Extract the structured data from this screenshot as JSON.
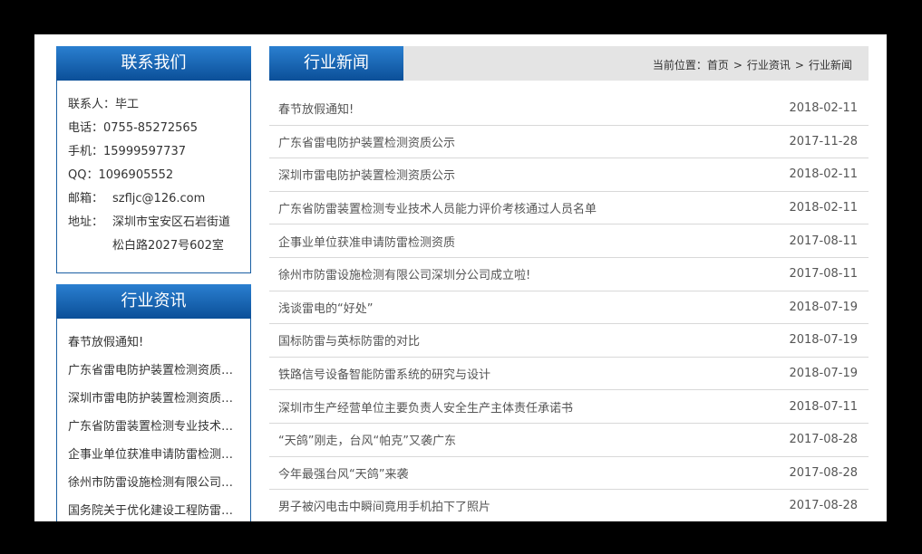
{
  "contact": {
    "title": "联系我们",
    "rows": [
      {
        "label": "联系人：",
        "value": "毕工"
      },
      {
        "label": "电话：",
        "value": "0755-85272565"
      },
      {
        "label": "手机：",
        "value": "15999597737"
      },
      {
        "label": "QQ：",
        "value": "1096905552"
      },
      {
        "label": "邮箱：",
        "value": "szfljc@126.com"
      },
      {
        "label": "地址：",
        "value": "深圳市宝安区石岩街道松白路2027号602室"
      }
    ]
  },
  "industry": {
    "title": "行业资讯",
    "items": [
      "春节放假通知!",
      "广东省雷电防护装置检测资质公示",
      "深圳市雷电防护装置检测资质公示",
      "广东省防雷装置检测专业技术人...",
      "企事业单位获准申请防雷检测资质",
      "徐州市防雷设施检测有限公司深...",
      "国务院关于优化建设工程防雷许..."
    ]
  },
  "main": {
    "title": "行业新闻",
    "breadcrumb": {
      "prefix": "当前位置：",
      "home": "首页",
      "sep": ">",
      "level1": "行业资讯",
      "level2": "行业新闻"
    },
    "news": [
      {
        "title": "春节放假通知!",
        "date": "2018-02-11"
      },
      {
        "title": "广东省雷电防护装置检测资质公示",
        "date": "2017-11-28"
      },
      {
        "title": "深圳市雷电防护装置检测资质公示",
        "date": "2018-02-11"
      },
      {
        "title": "广东省防雷装置检测专业技术人员能力评价考核通过人员名单",
        "date": "2018-02-11"
      },
      {
        "title": "企事业单位获准申请防雷检测资质",
        "date": "2017-08-11"
      },
      {
        "title": "徐州市防雷设施检测有限公司深圳分公司成立啦!",
        "date": "2017-08-11"
      },
      {
        "title": "浅谈雷电的“好处”",
        "date": "2018-07-19"
      },
      {
        "title": "国标防雷与英标防雷的对比",
        "date": "2018-07-19"
      },
      {
        "title": "铁路信号设备智能防雷系统的研究与设计",
        "date": "2018-07-19"
      },
      {
        "title": "深圳市生产经营单位主要负责人安全生产主体责任承诺书",
        "date": "2018-07-11"
      },
      {
        "title": "“天鸽”刚走，台风“帕克”又袭广东",
        "date": "2017-08-28"
      },
      {
        "title": "今年最强台风“天鸽”来袭",
        "date": "2017-08-28"
      },
      {
        "title": "男子被闪电击中瞬间竟用手机拍下了照片",
        "date": "2017-08-28"
      }
    ]
  }
}
